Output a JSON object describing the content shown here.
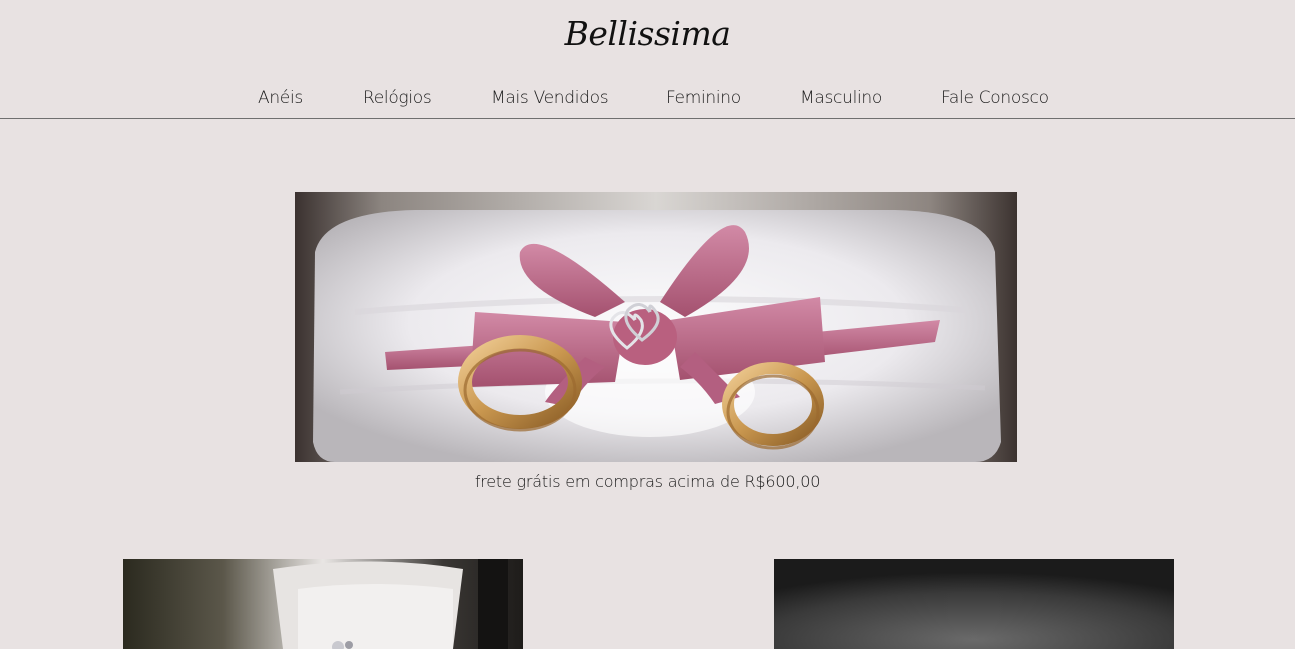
{
  "brand": {
    "logo_text": "Bellissima"
  },
  "nav": {
    "items": [
      {
        "label": "Anéis"
      },
      {
        "label": "Relógios"
      },
      {
        "label": "Mais Vendidos"
      },
      {
        "label": "Feminino"
      },
      {
        "label": "Masculino"
      },
      {
        "label": "Fale Conosco"
      }
    ]
  },
  "hero": {
    "image_alt": "wedding rings on pillow with pink ribbon"
  },
  "promo": {
    "text": "frete grátis em compras acima de R$600,00"
  },
  "products": [
    {
      "image_alt": "ring in jewelry box"
    },
    {
      "image_alt": "dark product photo"
    }
  ],
  "colors": {
    "background": "#e8e2e2",
    "divider": "#6f6f6f",
    "ribbon": "#c0708f",
    "gold": "#c9974f"
  }
}
